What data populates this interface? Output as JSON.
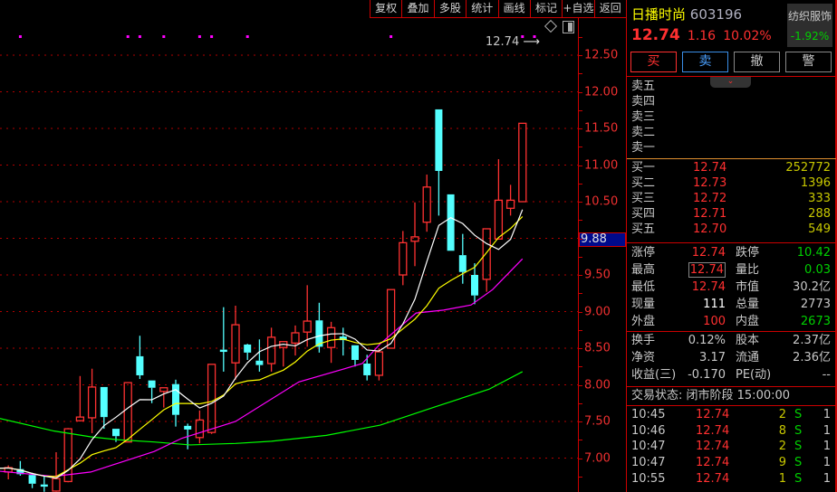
{
  "toolbar": {
    "items": [
      "复权",
      "叠加",
      "多股",
      "统计",
      "画线",
      "标记",
      "+自选",
      "返回"
    ]
  },
  "chart_data": {
    "type": "candlestick",
    "y_ticks": [
      "12.50",
      "12.00",
      "11.50",
      "11.00",
      "10.50",
      "9.50",
      "9.00",
      "8.50",
      "8.00",
      "7.50",
      "7.00"
    ],
    "y_tick_values": [
      12.5,
      12.0,
      11.5,
      11.0,
      10.5,
      9.5,
      9.0,
      8.5,
      8.0,
      7.5,
      7.0
    ],
    "ylim": [
      6.45,
      12.75
    ],
    "crosshair_price": "9.88",
    "latest_label": "12.74",
    "colors": {
      "up": "#ff3232",
      "down": "#54ffff",
      "ma5": "#ffffff",
      "ma10": "#ffff00",
      "ma20": "#ff00ff",
      "ma60": "#00ff00",
      "marker": "#ff00ff"
    },
    "ohlc": [
      [
        6.98,
        6.98,
        6.83,
        6.86
      ],
      [
        6.81,
        6.9,
        6.71,
        6.87
      ],
      [
        6.85,
        6.96,
        6.76,
        6.78
      ],
      [
        6.77,
        6.8,
        6.59,
        6.65
      ],
      [
        6.64,
        6.75,
        6.54,
        6.61
      ],
      [
        6.55,
        7.08,
        6.54,
        6.72
      ],
      [
        6.68,
        7.41,
        6.67,
        7.4
      ],
      [
        7.51,
        8.12,
        7.5,
        7.56
      ],
      [
        7.55,
        8.22,
        7.34,
        7.97
      ],
      [
        7.97,
        7.97,
        7.4,
        7.56
      ],
      [
        7.4,
        7.4,
        7.22,
        7.3
      ],
      [
        7.22,
        8.03,
        7.22,
        8.03
      ],
      [
        8.39,
        8.67,
        8.08,
        8.13
      ],
      [
        8.06,
        8.06,
        7.75,
        7.96
      ],
      [
        7.91,
        7.96,
        7.69,
        7.96
      ],
      [
        8.01,
        8.07,
        7.43,
        7.59
      ],
      [
        7.44,
        7.47,
        7.12,
        7.39
      ],
      [
        7.28,
        7.65,
        7.2,
        7.52
      ],
      [
        7.35,
        8.28,
        7.33,
        8.28
      ],
      [
        8.48,
        9.06,
        8.18,
        8.45
      ],
      [
        8.3,
        9.08,
        8.07,
        8.82
      ],
      [
        8.55,
        8.56,
        8.34,
        8.44
      ],
      [
        8.33,
        8.62,
        8.18,
        8.27
      ],
      [
        8.29,
        8.78,
        8.18,
        8.65
      ],
      [
        8.51,
        8.59,
        8.25,
        8.59
      ],
      [
        8.57,
        8.81,
        8.4,
        8.71
      ],
      [
        8.72,
        9.36,
        8.52,
        8.87
      ],
      [
        8.88,
        9.12,
        8.44,
        8.52
      ],
      [
        8.51,
        8.86,
        8.3,
        8.78
      ],
      [
        8.66,
        8.78,
        8.4,
        8.61
      ],
      [
        8.54,
        8.54,
        8.25,
        8.34
      ],
      [
        8.29,
        8.41,
        8.06,
        8.13
      ],
      [
        8.13,
        8.5,
        8.06,
        8.45
      ],
      [
        8.5,
        9.3,
        8.5,
        9.3
      ],
      [
        9.5,
        10.1,
        9.36,
        9.94
      ],
      [
        9.96,
        10.49,
        9.62,
        10.02
      ],
      [
        10.22,
        10.87,
        10.09,
        10.7
      ],
      [
        11.76,
        11.76,
        10.31,
        10.92
      ],
      [
        10.6,
        10.6,
        9.83,
        9.83
      ],
      [
        9.77,
        10.06,
        9.38,
        9.54
      ],
      [
        9.5,
        9.66,
        9.1,
        9.22
      ],
      [
        9.44,
        10.13,
        9.27,
        10.13
      ],
      [
        9.99,
        11.08,
        9.99,
        10.52
      ],
      [
        10.41,
        10.73,
        10.31,
        10.52
      ],
      [
        10.5,
        11.57,
        10.5,
        11.57
      ]
    ],
    "ma20": [
      [
        0.3,
        6.82
      ],
      [
        4.8,
        6.75
      ],
      [
        7.9,
        6.81
      ],
      [
        13.2,
        7.09
      ],
      [
        15.5,
        7.27
      ],
      [
        20,
        7.5
      ],
      [
        25.3,
        8.04
      ],
      [
        30.6,
        8.29
      ],
      [
        32.1,
        8.56
      ],
      [
        35.1,
        8.98
      ],
      [
        37.4,
        9.02
      ],
      [
        39.7,
        9.09
      ],
      [
        41.5,
        9.3
      ],
      [
        44,
        9.72
      ]
    ],
    "ma60": [
      [
        0.3,
        7.54
      ],
      [
        4.8,
        7.37
      ],
      [
        7.9,
        7.29
      ],
      [
        10.2,
        7.25
      ],
      [
        13.2,
        7.22
      ],
      [
        16.2,
        7.18
      ],
      [
        20,
        7.2
      ],
      [
        23,
        7.23
      ],
      [
        27.6,
        7.31
      ],
      [
        32.1,
        7.45
      ],
      [
        36.7,
        7.7
      ],
      [
        41.2,
        7.94
      ],
      [
        44,
        8.18
      ]
    ],
    "markers": [
      2,
      11,
      12,
      14,
      17,
      18,
      21,
      33,
      44,
      45
    ]
  },
  "quote": {
    "name": "日播时尚",
    "code": "603196",
    "price": "12.74",
    "change": "1.16",
    "change_pct": "10.02%",
    "industry": "纺织服饰",
    "industry_pct": "-1.92%"
  },
  "trade_buttons": {
    "buy": "买",
    "sell": "卖",
    "cancel": "撤",
    "alert": "警"
  },
  "asks": [
    {
      "label": "卖五"
    },
    {
      "label": "卖四"
    },
    {
      "label": "卖三"
    },
    {
      "label": "卖二"
    },
    {
      "label": "卖一"
    }
  ],
  "bids": [
    {
      "label": "买一",
      "price": "12.74",
      "vol": "252772"
    },
    {
      "label": "买二",
      "price": "12.73",
      "vol": "1396"
    },
    {
      "label": "买三",
      "price": "12.72",
      "vol": "333"
    },
    {
      "label": "买四",
      "price": "12.71",
      "vol": "288"
    },
    {
      "label": "买五",
      "price": "12.70",
      "vol": "549"
    }
  ],
  "stats": [
    {
      "l1": "涨停",
      "v1": "12.74",
      "l2": "跌停",
      "v2": "10.42"
    },
    {
      "l1": "最高",
      "v1": "12.74",
      "l2": "量比",
      "v2": "0.03"
    },
    {
      "l1": "最低",
      "v1": "12.74",
      "l2": "市值",
      "v2": "30.2亿"
    },
    {
      "l1": "现量",
      "v1": "111",
      "l2": "总量",
      "v2": "2773"
    },
    {
      "l1": "外盘",
      "v1": "100",
      "l2": "内盘",
      "v2": "2673"
    }
  ],
  "fund": [
    {
      "l1": "换手",
      "v1": "0.12%",
      "l2": "股本",
      "v2": "2.37亿"
    },
    {
      "l1": "净资",
      "v1": "3.17",
      "l2": "流通",
      "v2": "2.36亿"
    },
    {
      "l1": "收益(三)",
      "v1": "-0.170",
      "l2": "PE(动)",
      "v2": "--"
    }
  ],
  "status": "交易状态: 闭市阶段 15:00:00",
  "ticks": [
    {
      "time": "10:45",
      "price": "12.74",
      "vol": "2",
      "side": "S",
      "n": "1"
    },
    {
      "time": "10:46",
      "price": "12.74",
      "vol": "8",
      "side": "S",
      "n": "1"
    },
    {
      "time": "10:47",
      "price": "12.74",
      "vol": "2",
      "side": "S",
      "n": "1"
    },
    {
      "time": "10:47",
      "price": "12.74",
      "vol": "9",
      "side": "S",
      "n": "1"
    },
    {
      "time": "10:55",
      "price": "12.74",
      "vol": "1",
      "side": "S",
      "n": "1"
    }
  ]
}
